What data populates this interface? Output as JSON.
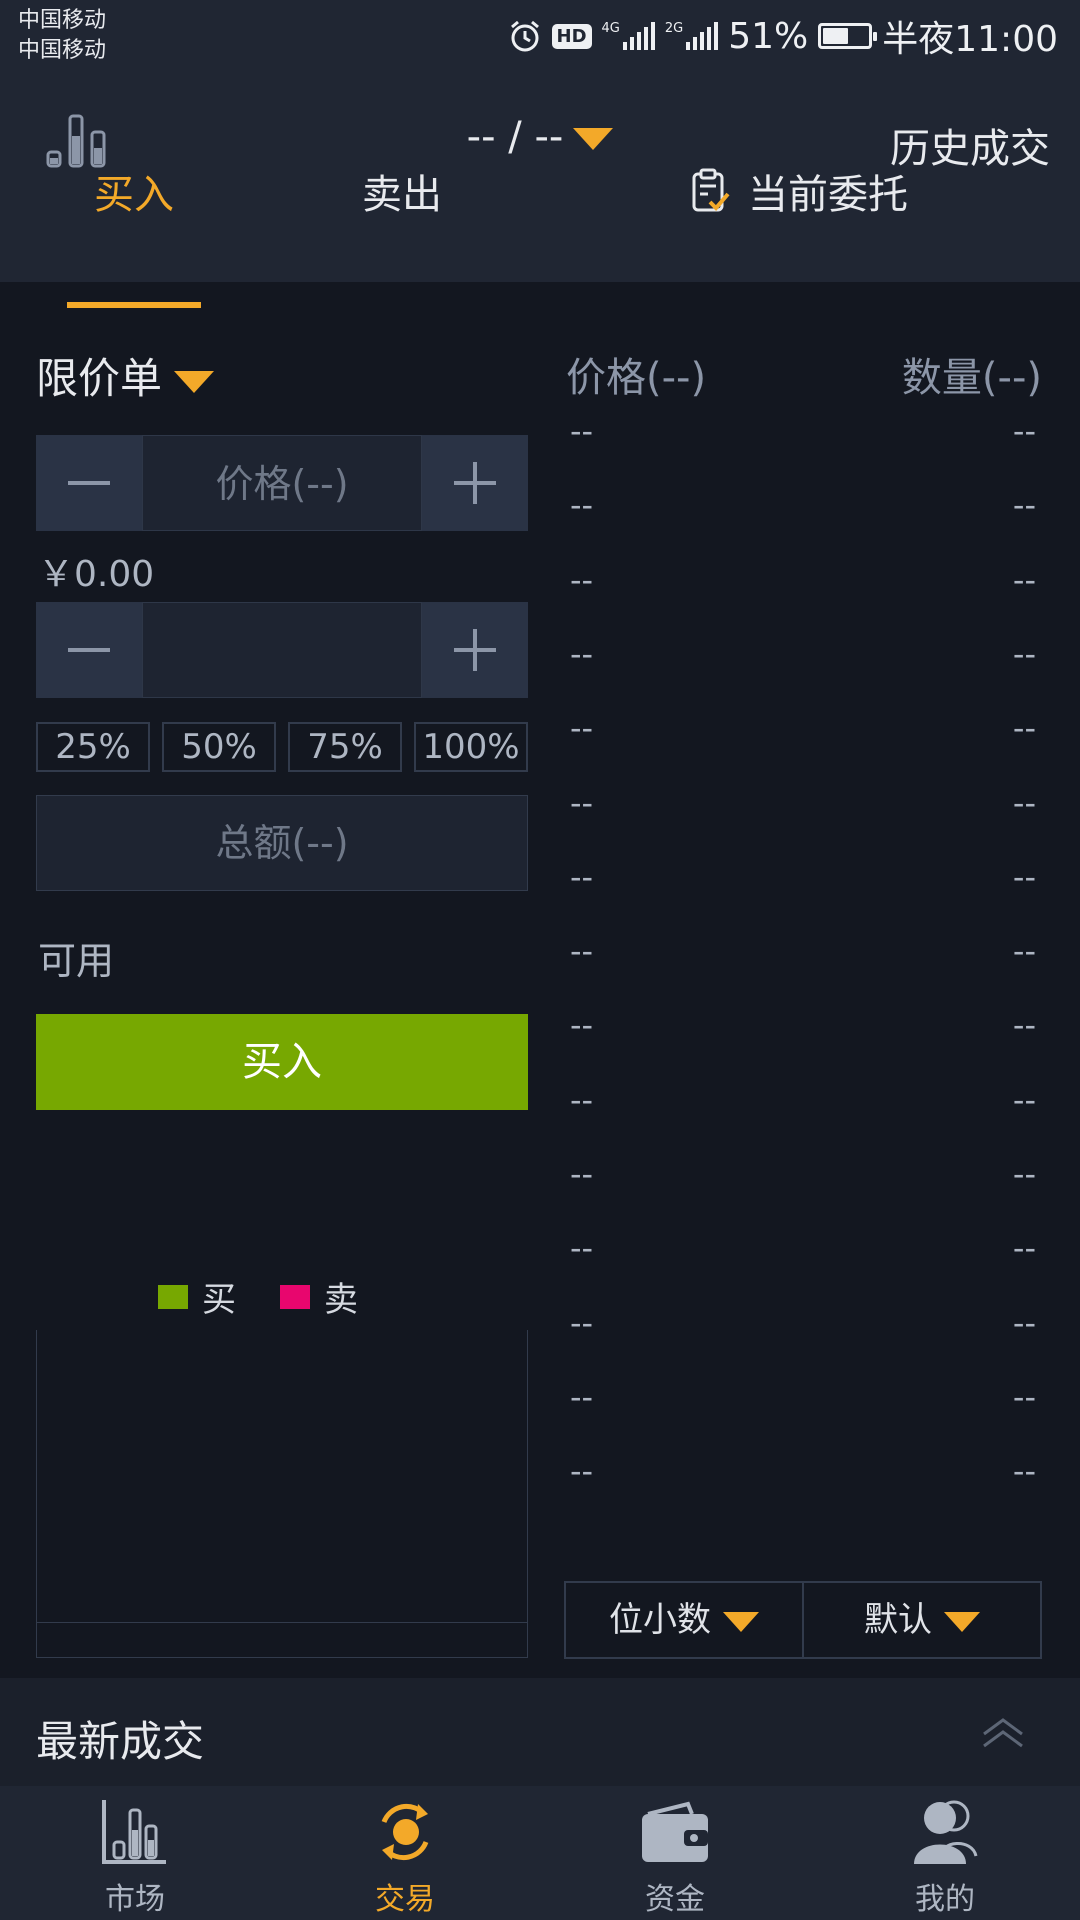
{
  "status_bar": {
    "carrier1": "中国移动",
    "carrier2": "中国移动",
    "hd": "HD",
    "net1": "4G",
    "net2": "2G",
    "battery": "51%",
    "battery_level": 0.51,
    "time": "半夜11:00"
  },
  "header": {
    "pair": "-- / --",
    "history": "历史成交"
  },
  "tabs": {
    "buy": "买入",
    "sell": "卖出",
    "orders": "当前委托",
    "active": "buy"
  },
  "order_form": {
    "order_type": "限价单",
    "price_placeholder": "价格(--)",
    "cny_value": "￥0.00",
    "amount_value": "",
    "percents": [
      "25%",
      "50%",
      "75%",
      "100%"
    ],
    "total_placeholder": "总额(--)",
    "available_label": "可用",
    "submit_label": "买入"
  },
  "depth_legend": {
    "buy": "买",
    "sell": "卖",
    "buy_color": "#77a801",
    "sell_color": "#e8066e"
  },
  "orderbook": {
    "price_header": "价格(--)",
    "qty_header": "数量(--)",
    "rows": [
      {
        "p": "--",
        "q": "--"
      },
      {
        "p": "--",
        "q": "--"
      },
      {
        "p": "--",
        "q": "--"
      },
      {
        "p": "--",
        "q": "--"
      },
      {
        "p": "--",
        "q": "--"
      },
      {
        "p": "--",
        "q": "--"
      },
      {
        "p": "--",
        "q": "--"
      },
      {
        "p": "--",
        "q": "--"
      },
      {
        "p": "--",
        "q": "--"
      },
      {
        "p": "--",
        "q": "--"
      },
      {
        "p": "--",
        "q": "--"
      },
      {
        "p": "--",
        "q": "--"
      },
      {
        "p": "--",
        "q": "--"
      },
      {
        "p": "--",
        "q": "--"
      },
      {
        "p": "--",
        "q": "--"
      }
    ],
    "decimals_label": "位小数",
    "group_label": "默认"
  },
  "latest_trades": {
    "label": "最新成交"
  },
  "nav": {
    "market": "市场",
    "trade": "交易",
    "funds": "资金",
    "mine": "我的",
    "active": "trade"
  },
  "colors": {
    "accent": "#f3a929",
    "buy_green": "#77a801",
    "sell_pink": "#e8066e",
    "background": "#131720",
    "panel": "#202633"
  }
}
